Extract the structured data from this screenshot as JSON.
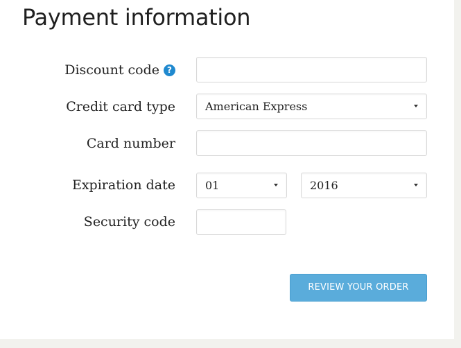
{
  "title": "Payment information",
  "form": {
    "discount_code": {
      "label": "Discount code",
      "help_icon": "question-circle-icon",
      "value": ""
    },
    "card_type": {
      "label": "Credit card type",
      "selected": "American Express"
    },
    "card_number": {
      "label": "Card number",
      "value": ""
    },
    "expiration": {
      "label": "Expiration date",
      "month": "01",
      "year": "2016"
    },
    "security_code": {
      "label": "Security code",
      "value": ""
    }
  },
  "submit_label": "REVIEW YOUR ORDER",
  "colors": {
    "button": "#5aacdb",
    "help_icon": "#1f89cf",
    "background": "#f2f2ee"
  }
}
